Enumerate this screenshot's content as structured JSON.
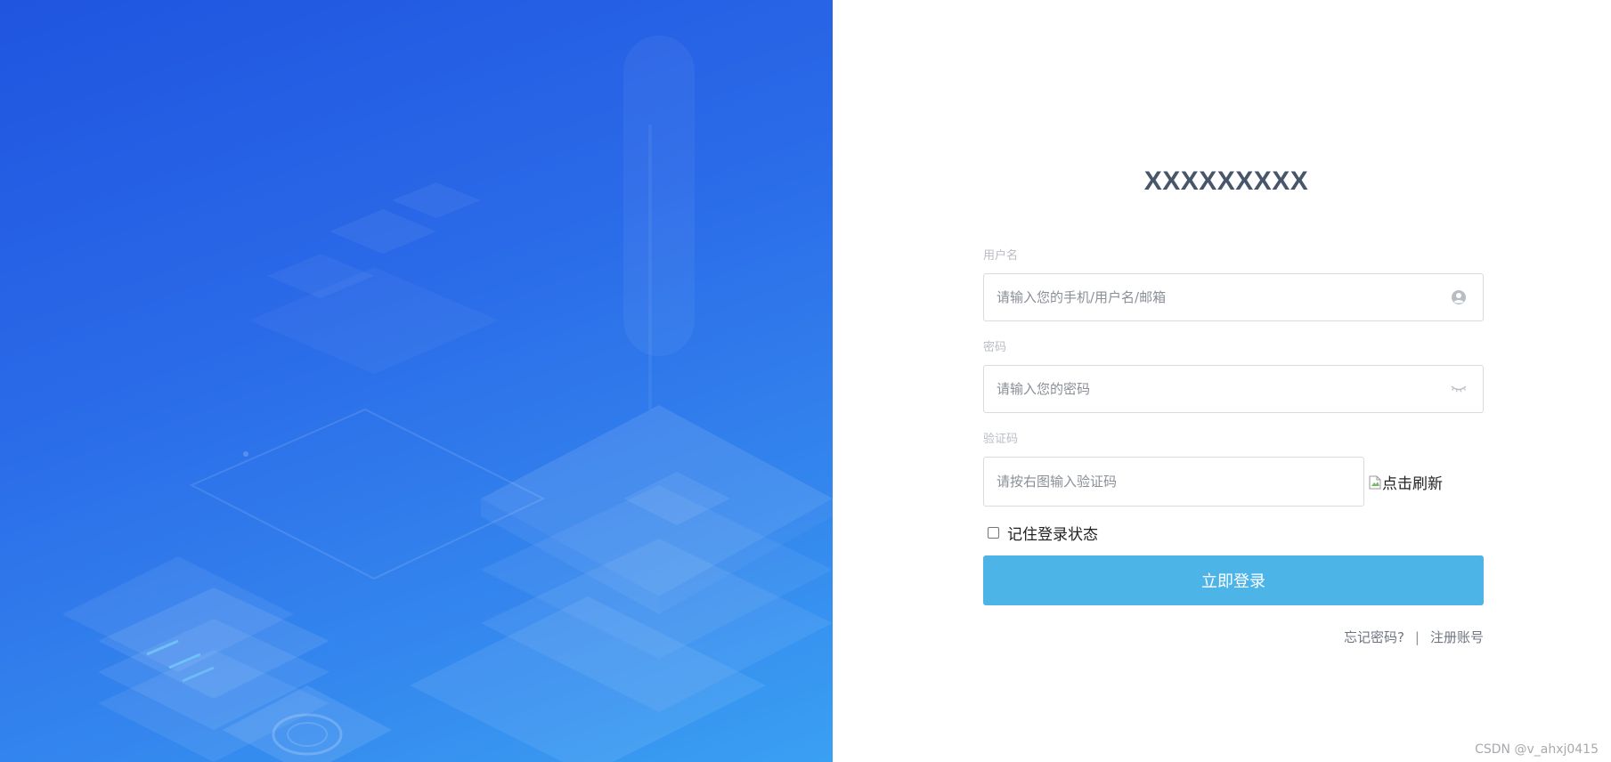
{
  "login": {
    "title": "XXXXXXXXX",
    "username": {
      "label": "用户名",
      "placeholder": "请输入您的手机/用户名/邮箱",
      "icon": "user-icon"
    },
    "password": {
      "label": "密码",
      "placeholder": "请输入您的密码",
      "icon": "eye-closed-icon"
    },
    "captcha": {
      "label": "验证码",
      "placeholder": "请按右图输入验证码",
      "image_alt": "点击刷新"
    },
    "remember_label": "记住登录状态",
    "remember_checked": false,
    "submit_label": "立即登录",
    "forgot_label": "忘记密码?",
    "separator": "|",
    "register_label": "注册账号"
  },
  "watermark": "CSDN @v_ahxj0415",
  "colors": {
    "left_panel_top": "#1f55e0",
    "left_panel_bottom": "#3aa0f2",
    "title": "#48566a",
    "button": "#4db4e8",
    "label": "#b9bdc4"
  }
}
